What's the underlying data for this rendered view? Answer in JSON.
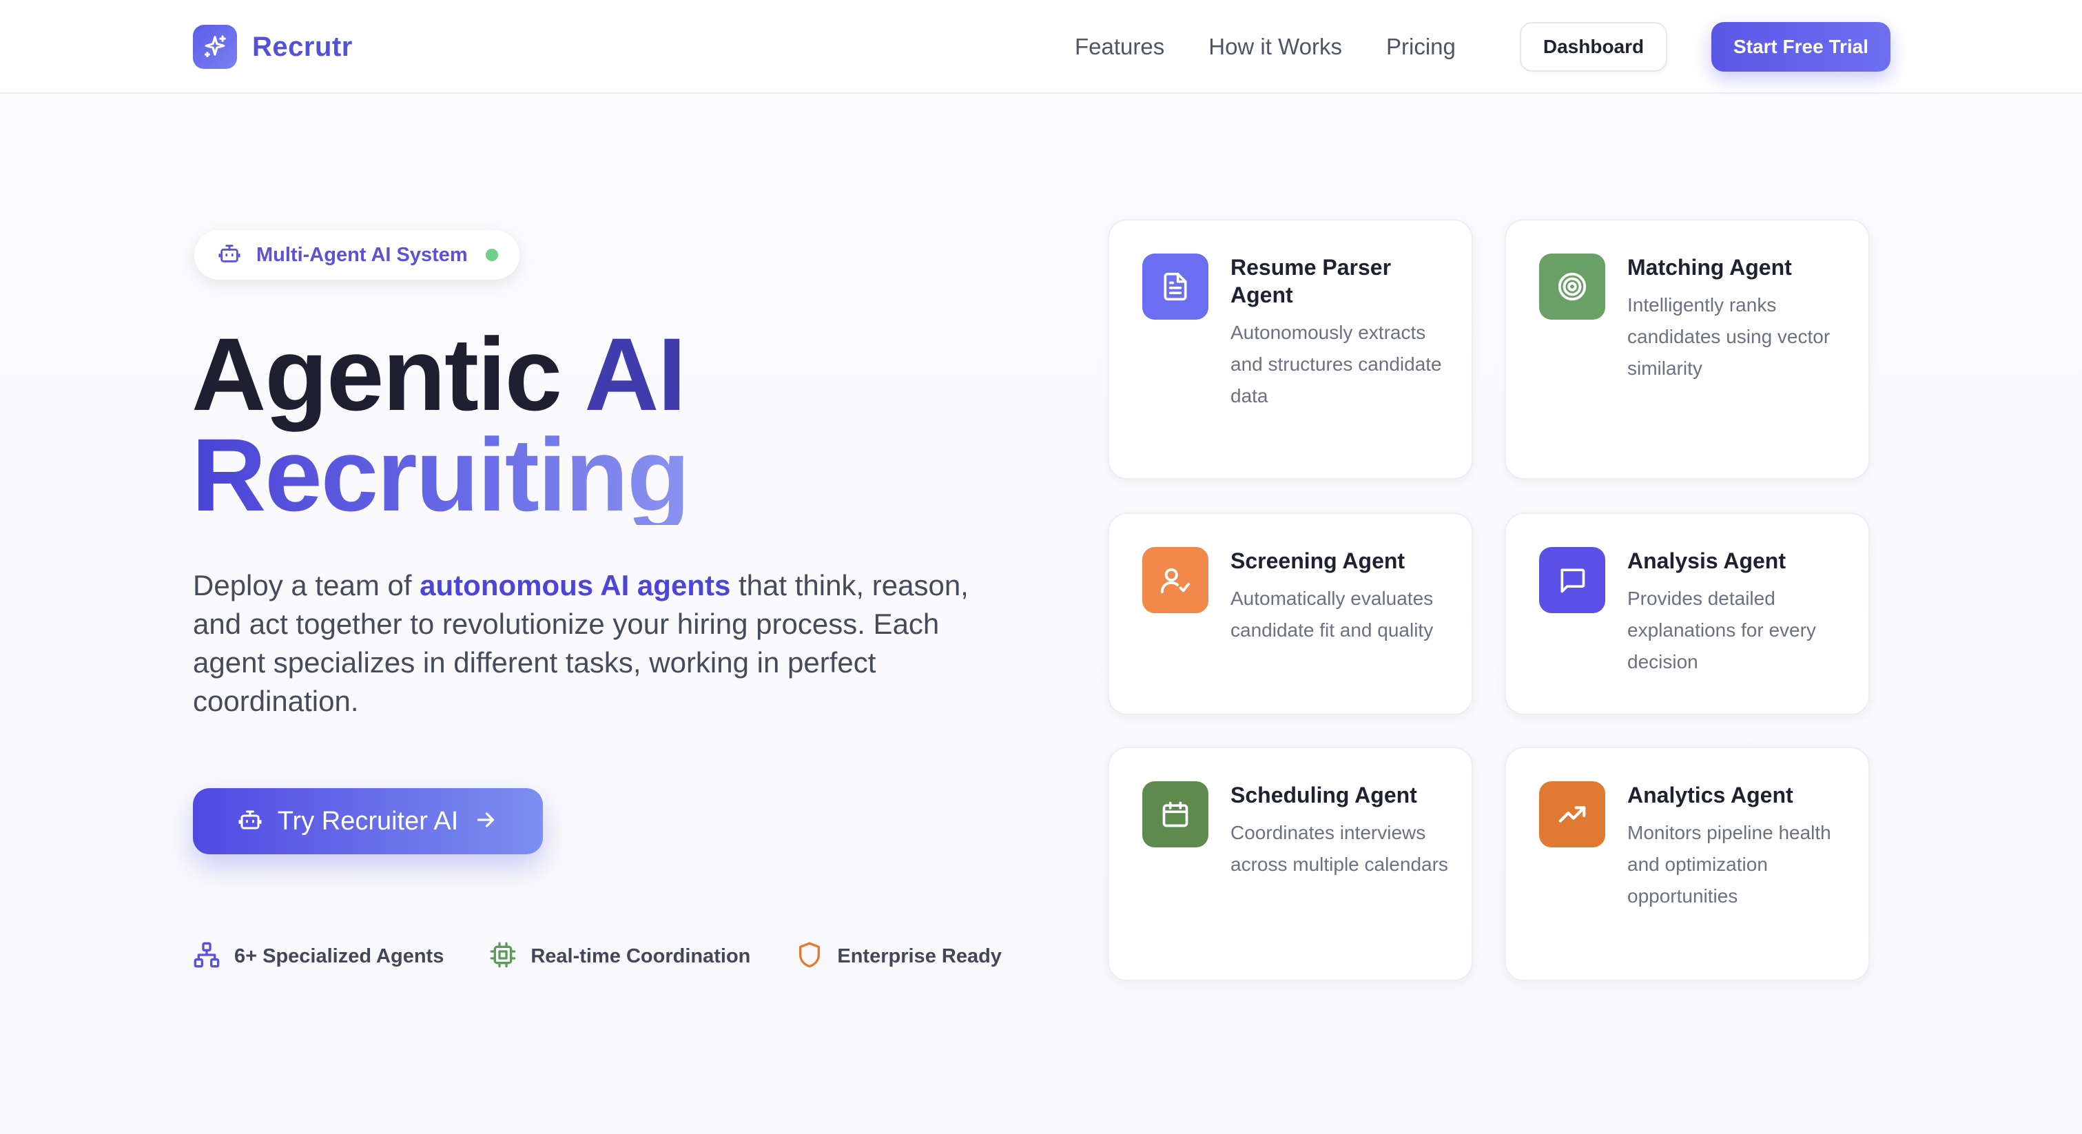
{
  "navbar": {
    "brand_name": "Recrutr",
    "links": [
      "Features",
      "How it Works",
      "Pricing"
    ],
    "dashboard_label": "Dashboard",
    "trial_label": "Start Free Trial"
  },
  "hero": {
    "badge": "Multi-Agent AI System",
    "title_line1_a": "Agentic ",
    "title_line1_b": "AI",
    "title_line2": "Recruiting",
    "desc_before": "Deploy a team of ",
    "desc_highlight": "autonomous AI agents",
    "desc_after": " that think, reason, and act together to revolutionize your hiring process. Each agent specializes in different tasks, working in perfect coordination.",
    "cta_label": "Try Recruiter AI",
    "features": [
      {
        "icon": "network-icon",
        "label": "6+ Specialized Agents"
      },
      {
        "icon": "chip-icon",
        "label": "Real-time Coordination"
      },
      {
        "icon": "shield-icon",
        "label": "Enterprise Ready"
      }
    ]
  },
  "agents": [
    {
      "title": "Resume Parser Agent",
      "desc": "Autonomously extracts and structures candidate data",
      "icon": "document-icon",
      "color": "#6b6ef0"
    },
    {
      "title": "Matching Agent",
      "desc": "Intelligently ranks candidates using vector similarity",
      "icon": "target-icon",
      "color": "#6aa065"
    },
    {
      "title": "Screening Agent",
      "desc": "Automatically evaluates candidate fit and quality",
      "icon": "user-check-icon",
      "color": "#f0894a"
    },
    {
      "title": "Analysis Agent",
      "desc": "Provides detailed explanations for every decision",
      "icon": "chat-icon",
      "color": "#5a50e6"
    },
    {
      "title": "Scheduling Agent",
      "desc": "Coordinates interviews across multiple calendars",
      "icon": "calendar-icon",
      "color": "#5e8a50"
    },
    {
      "title": "Analytics Agent",
      "desc": "Monitors pipeline health and optimization opportunities",
      "icon": "trending-up-icon",
      "color": "#e07a33"
    }
  ]
}
